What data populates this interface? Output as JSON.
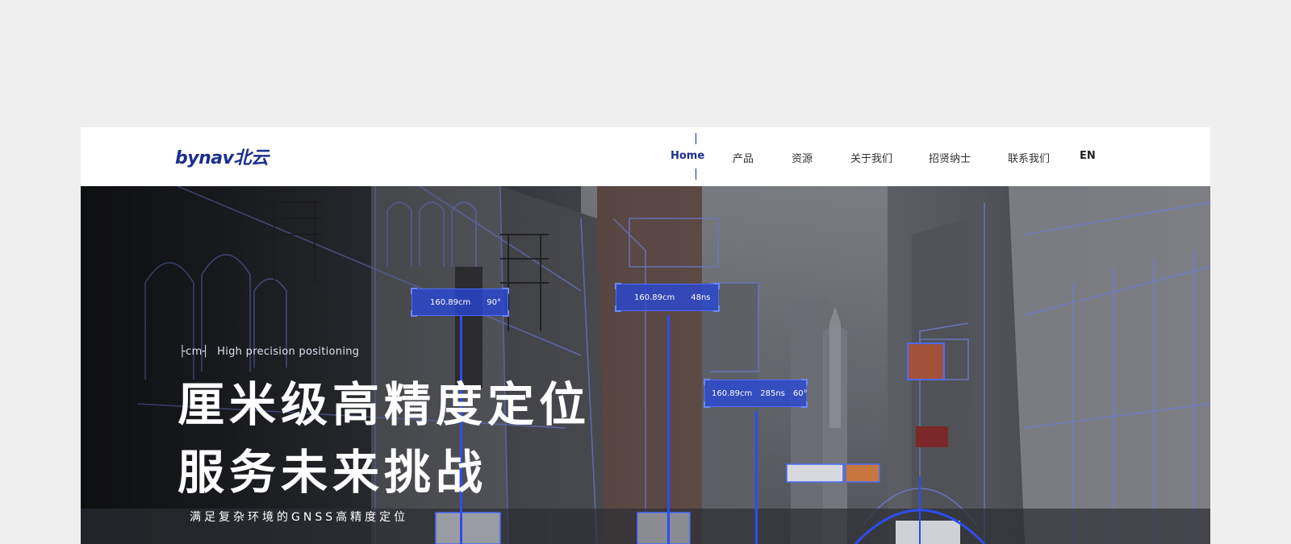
{
  "header": {
    "logo_text": "bynav北云",
    "nav": [
      {
        "label": "Home",
        "active": true
      },
      {
        "label": "产品"
      },
      {
        "label": "资源"
      },
      {
        "label": "关于我们"
      },
      {
        "label": "招贤纳士"
      },
      {
        "label": "联系我们"
      },
      {
        "label": "EN"
      }
    ]
  },
  "hero": {
    "tagline_unit": "cm",
    "tagline_text": "High precision positioning",
    "headline_1": "厘米级高精度定位",
    "headline_2": "服务未来挑战",
    "subtitle": "满足复杂环境的GNSS高精度定位",
    "tags": [
      {
        "distance": "160.89cm",
        "value": "90°"
      },
      {
        "distance": "160.89cm",
        "value": "48ns"
      },
      {
        "distance": "160.89cm",
        "value": "285ns",
        "extra": "60°"
      }
    ]
  },
  "colors": {
    "brand": "#1b2f8f",
    "overlay_blue": "#2846d7",
    "page_bg": "#efefef"
  }
}
